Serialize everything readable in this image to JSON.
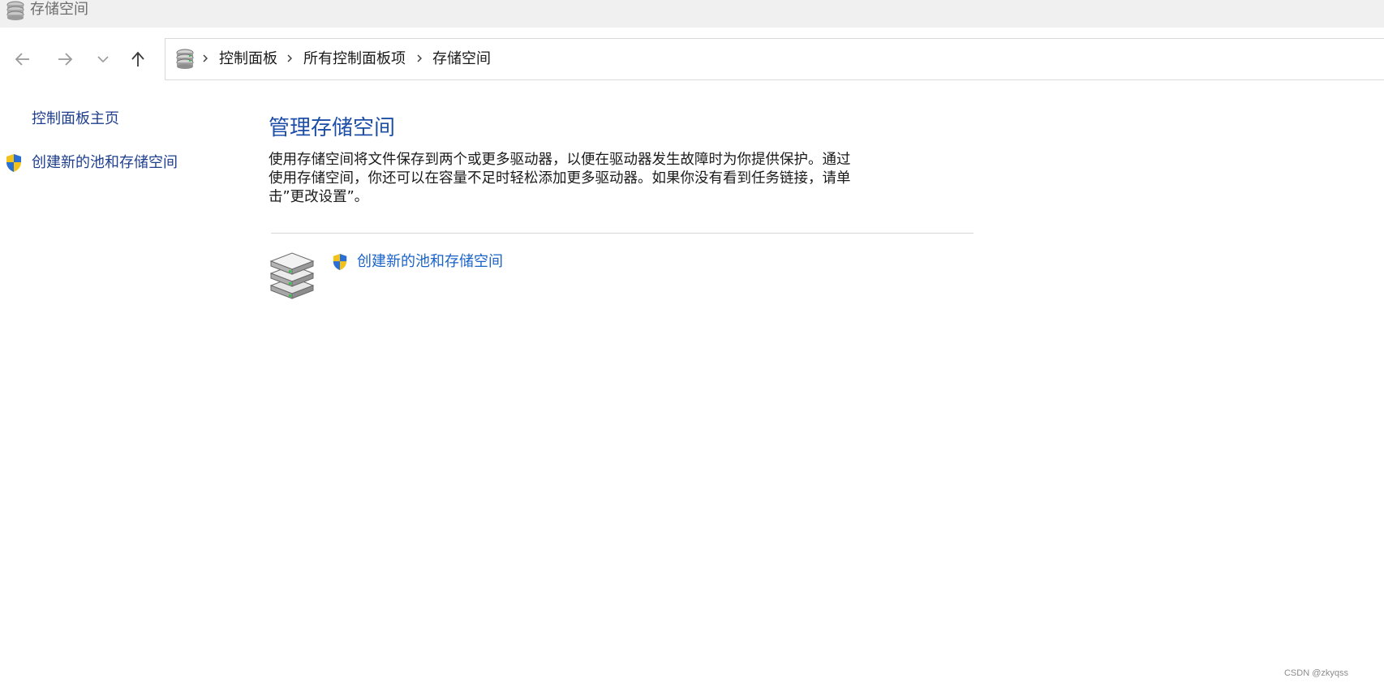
{
  "window": {
    "title": "存储空间",
    "icon": "storage-spaces-icon"
  },
  "nav": {
    "back_icon": "arrow-left-icon",
    "forward_icon": "arrow-right-icon",
    "recent_icon": "chevron-down-icon",
    "up_icon": "arrow-up-icon"
  },
  "address": {
    "icon": "storage-spaces-icon",
    "breadcrumbs": [
      "控制面板",
      "所有控制面板项",
      "存储空间"
    ]
  },
  "sidebar": {
    "home_label": "控制面板主页",
    "create_label": "创建新的池和存储空间"
  },
  "main": {
    "title": "管理存储空间",
    "description": "使用存储空间将文件保存到两个或更多驱动器，以便在驱动器发生故障时为你提供保护。通过使用存储空间，你还可以在容量不足时轻松添加更多驱动器。如果你没有看到任务链接，请单击”更改设置”。",
    "task_label": "创建新的池和存储空间",
    "task_icon": "drive-stack-icon"
  },
  "watermark": "CSDN @zkyqss",
  "colors": {
    "link": "#1a63c9",
    "heading": "#1e4fa8",
    "sidebar_link": "#1f3f8e"
  }
}
